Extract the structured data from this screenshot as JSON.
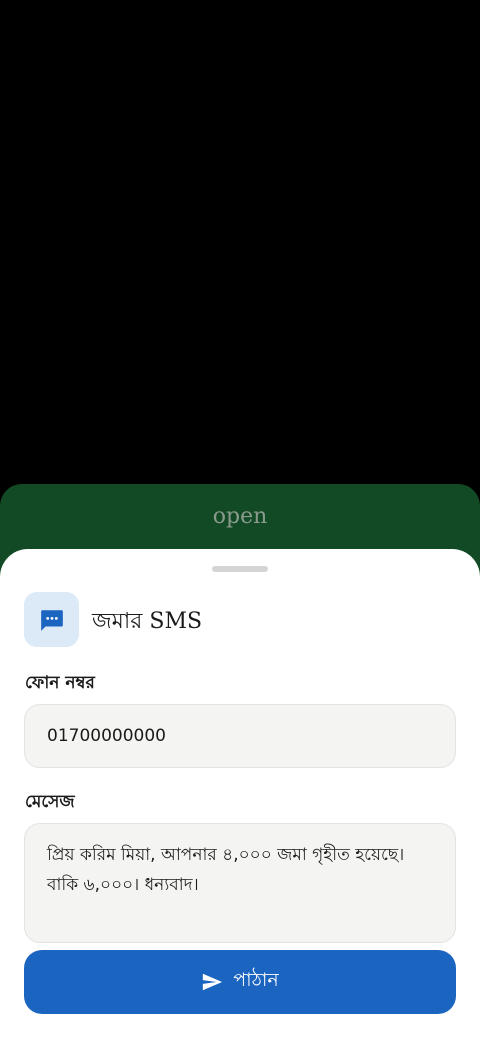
{
  "background_action": {
    "label": "open"
  },
  "sheet": {
    "title": "জমার SMS",
    "icon": "sms-icon",
    "phone_label": "ফোন নম্বর",
    "phone_value": "01700000000",
    "message_label": "মেসেজ",
    "message_value": "প্রিয় করিম মিয়া, আপনার ৪,০০০ জমা গৃহীত হয়েছে। বাকি ৬,০০০। ধন্যবাদ।",
    "send_label": "পাঠান",
    "send_icon": "send-icon"
  },
  "colors": {
    "open_bar": "#114a25",
    "accent": "#1b64c0",
    "icon_bg": "#dce9f7",
    "field_bg": "#f4f5f3"
  }
}
